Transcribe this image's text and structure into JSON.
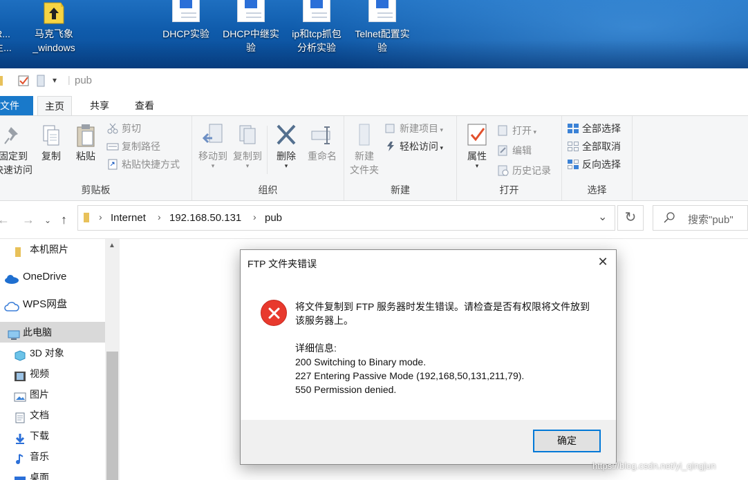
{
  "desktop": {
    "icons": [
      {
        "name": "desktop-icon-partial",
        "label_line1": "R...",
        "label_line2": "主..."
      },
      {
        "name": "desktop-icon-makefei",
        "label_line1": "马克飞象",
        "label_line2": "_windows"
      },
      {
        "name": "desktop-icon-dhcp",
        "label_line1": "DHCP实验",
        "label_line2": ""
      },
      {
        "name": "desktop-icon-dhcp-relay",
        "label_line1": "DHCP中继实",
        "label_line2": "验"
      },
      {
        "name": "desktop-icon-iptcp",
        "label_line1": "ip和tcp抓包",
        "label_line2": "分析实验"
      },
      {
        "name": "desktop-icon-telnet",
        "label_line1": "Telnet配置实",
        "label_line2": "验"
      }
    ]
  },
  "window": {
    "title": "pub"
  },
  "ribbon": {
    "tabs": {
      "file": "文件",
      "home": "主页",
      "share": "共享",
      "view": "查看"
    },
    "clipboard": {
      "pin_line1": "固定到",
      "pin_line2": "快速访问",
      "copy": "复制",
      "paste": "粘贴",
      "cut": "剪切",
      "copy_path": "复制路径",
      "paste_shortcut": "粘贴快捷方式",
      "group": "剪贴板"
    },
    "organize": {
      "move_to": "移动到",
      "copy_to": "复制到",
      "delete": "删除",
      "rename": "重命名",
      "group": "组织"
    },
    "new": {
      "new_folder_line1": "新建",
      "new_folder_line2": "文件夹",
      "new_item": "新建项目",
      "easy_access": "轻松访问",
      "group": "新建"
    },
    "open": {
      "properties": "属性",
      "open": "打开",
      "edit": "编辑",
      "history": "历史记录",
      "group": "打开"
    },
    "select": {
      "select_all": "全部选择",
      "select_none": "全部取消",
      "invert": "反向选择",
      "group": "选择"
    }
  },
  "address": {
    "crumbs": [
      "Internet",
      "192.168.50.131",
      "pub"
    ],
    "search_placeholder": "搜索\"pub\""
  },
  "sidebar": {
    "items": [
      {
        "label": "本机照片",
        "icon": "folder-icon"
      },
      {
        "label": "OneDrive",
        "icon": "cloud-icon"
      },
      {
        "label": "WPS网盘",
        "icon": "cloud-outline-icon"
      },
      {
        "label": "此电脑",
        "icon": "computer-icon",
        "selected": true
      },
      {
        "label": "3D 对象",
        "icon": "cube-icon"
      },
      {
        "label": "视频",
        "icon": "film-icon"
      },
      {
        "label": "图片",
        "icon": "picture-icon"
      },
      {
        "label": "文档",
        "icon": "document-icon"
      },
      {
        "label": "下载",
        "icon": "download-icon"
      },
      {
        "label": "音乐",
        "icon": "music-icon"
      },
      {
        "label": "桌面",
        "icon": "desktop-icon"
      }
    ]
  },
  "dialog": {
    "title": "FTP 文件夹错误",
    "message_line1": "将文件复制到 FTP 服务器时发生错误。请检查是否有权限将文件放到",
    "message_line2": "该服务器上。",
    "details_header": "详细信息:",
    "detail_lines": [
      "200 Switching to Binary mode.",
      "227 Entering Passive Mode (192,168,50,131,211,79).",
      "550 Permission denied."
    ],
    "ok": "确定"
  },
  "watermark": "https://blog.csdn.net/yi_qingjun"
}
